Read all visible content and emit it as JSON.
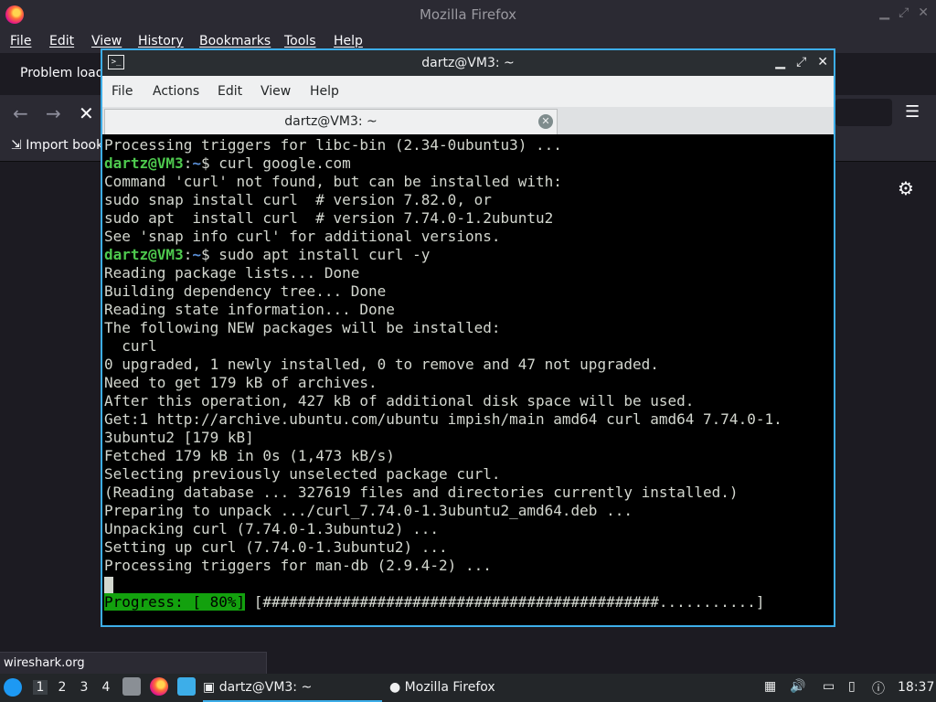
{
  "firefox": {
    "title": "Mozilla Firefox",
    "menu": [
      "File",
      "Edit",
      "View",
      "History",
      "Bookmarks",
      "Tools",
      "Help"
    ],
    "tab_label": "Problem load",
    "bookmark_label": "Import book",
    "status_url": "wireshark.org"
  },
  "terminal": {
    "title": "dartz@VM3: ~",
    "menu": [
      "File",
      "Actions",
      "Edit",
      "View",
      "Help"
    ],
    "tab_label": "dartz@VM3: ~",
    "prompt_user": "dartz@VM3",
    "prompt_path": "~",
    "lines": [
      "Processing triggers for libc-bin (2.34-0ubuntu3) ...",
      "curl google.com",
      "Command 'curl' not found, but can be installed with:",
      "sudo snap install curl  # version 7.82.0, or",
      "sudo apt  install curl  # version 7.74.0-1.2ubuntu2",
      "See 'snap info curl' for additional versions.",
      "sudo apt install curl -y",
      "Reading package lists... Done",
      "Building dependency tree... Done",
      "Reading state information... Done",
      "The following NEW packages will be installed:",
      "  curl",
      "0 upgraded, 1 newly installed, 0 to remove and 47 not upgraded.",
      "Need to get 179 kB of archives.",
      "After this operation, 427 kB of additional disk space will be used.",
      "Get:1 http://archive.ubuntu.com/ubuntu impish/main amd64 curl amd64 7.74.0-1.",
      "3ubuntu2 [179 kB]",
      "Fetched 179 kB in 0s (1,473 kB/s)",
      "Selecting previously unselected package curl.",
      "(Reading database ... 327619 files and directories currently installed.)",
      "Preparing to unpack .../curl_7.74.0-1.3ubuntu2_amd64.deb ...",
      "Unpacking curl (7.74.0-1.3ubuntu2) ...",
      "Setting up curl (7.74.0-1.3ubuntu2) ...",
      "Processing triggers for man-db (2.9.4-2) ..."
    ],
    "progress_label": "Progress: [ 80%]",
    "progress_bar": "[#############################################...........]",
    "progress_percent": 80
  },
  "taskbar": {
    "workspaces": [
      "1",
      "2",
      "3",
      "4"
    ],
    "tasks": [
      "dartz@VM3: ~",
      "Mozilla Firefox"
    ],
    "clock": "18:37"
  },
  "colors": {
    "accent": "#3daee9",
    "prompt_user": "#4ec94e",
    "prompt_path": "#5a8fd6",
    "progress": "#13a10e"
  }
}
